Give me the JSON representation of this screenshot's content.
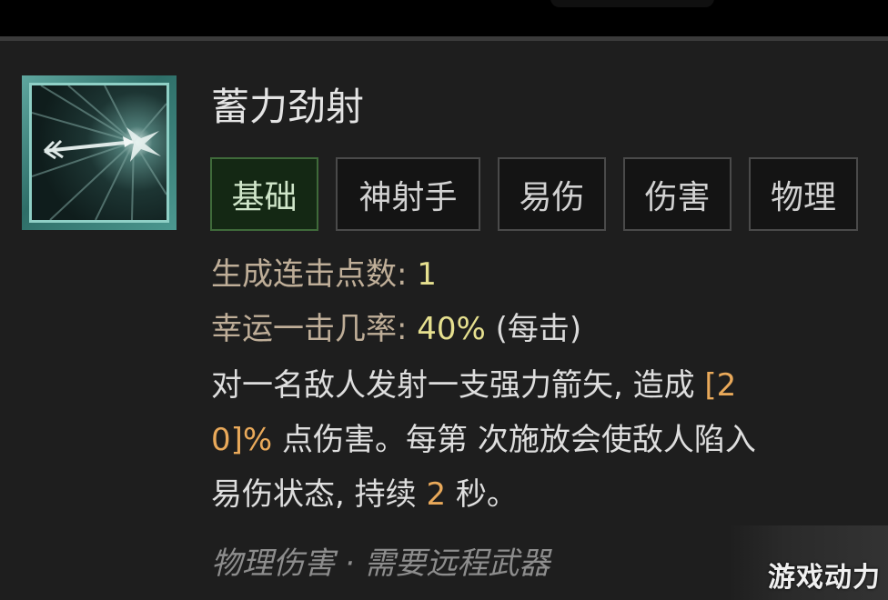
{
  "skill": {
    "name": "蓄力劲射",
    "icon": "arrow-burst-icon"
  },
  "tags": [
    "基础",
    "神射手",
    "易伤",
    "伤害",
    "物理"
  ],
  "stats": {
    "combo_label": "生成连击点数: ",
    "combo_value": "1",
    "lucky_label": "幸运一击几率: ",
    "lucky_value": "40%",
    "lucky_suffix": " (每击)"
  },
  "description": {
    "line1_text": "对一名敌人发射一支强力箭矢, 造成 ",
    "line1_value": "[2",
    "line2_value": "0]%",
    "line2_text": " 点伤害。每第  次施放会使敌人陷入",
    "line3_text": "易伤状态, 持续 ",
    "line3_value": "2",
    "line3_suffix": " 秒。"
  },
  "footer": "物理伤害 · 需要远程武器",
  "watermark": "游戏动力",
  "colors": {
    "background": "#1e1e1e",
    "active_tag": "#142814",
    "stat_label": "#bfae98",
    "stat_value": "#e6e08f",
    "damage_value": "#e9a95a"
  }
}
